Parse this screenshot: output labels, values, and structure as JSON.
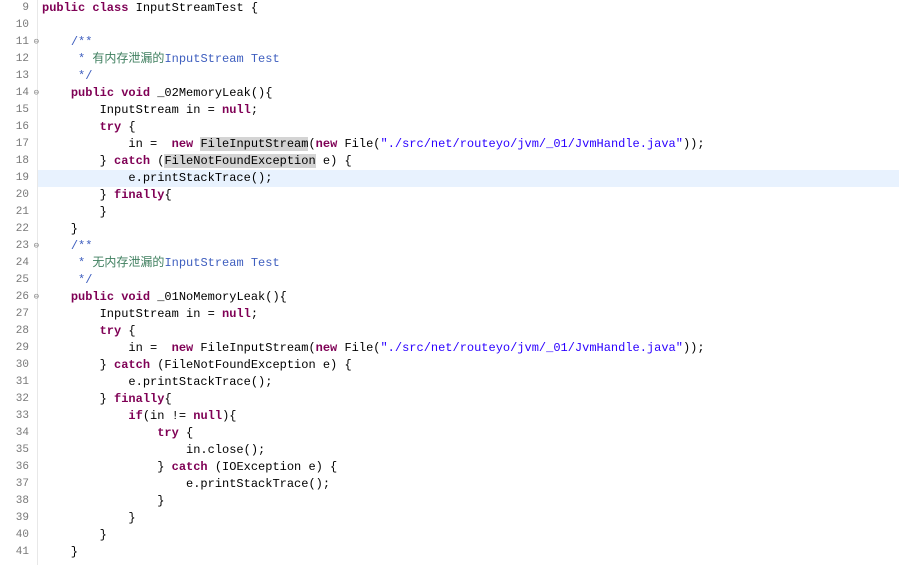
{
  "lines": [
    {
      "num": 9,
      "fold": "",
      "segments": [
        [
          "kw",
          "public class"
        ],
        [
          "normal",
          " InputStreamTest {"
        ]
      ]
    },
    {
      "num": 10,
      "fold": "",
      "segments": [
        [
          "normal",
          ""
        ]
      ]
    },
    {
      "num": 11,
      "fold": "⊖",
      "segments": [
        [
          "normal",
          "    "
        ],
        [
          "comment",
          "/**"
        ]
      ]
    },
    {
      "num": 12,
      "fold": "",
      "segments": [
        [
          "normal",
          "    "
        ],
        [
          "comment",
          " * "
        ],
        [
          "comment-cjk",
          "有内存泄漏的"
        ],
        [
          "comment",
          "InputStream Test"
        ]
      ]
    },
    {
      "num": 13,
      "fold": "",
      "segments": [
        [
          "normal",
          "    "
        ],
        [
          "comment",
          " */"
        ]
      ]
    },
    {
      "num": 14,
      "fold": "⊖",
      "segments": [
        [
          "normal",
          "    "
        ],
        [
          "kw",
          "public void"
        ],
        [
          "normal",
          " _02MemoryLeak(){"
        ]
      ]
    },
    {
      "num": 15,
      "fold": "",
      "segments": [
        [
          "normal",
          "        InputStream in = "
        ],
        [
          "kw",
          "null"
        ],
        [
          "normal",
          ";"
        ]
      ]
    },
    {
      "num": 16,
      "fold": "",
      "segments": [
        [
          "normal",
          "        "
        ],
        [
          "kw",
          "try"
        ],
        [
          "normal",
          " {"
        ]
      ]
    },
    {
      "num": 17,
      "fold": "",
      "segments": [
        [
          "normal",
          "            in =  "
        ],
        [
          "kw",
          "new"
        ],
        [
          "normal",
          " "
        ],
        [
          "occur",
          "FileInputStream"
        ],
        [
          "normal",
          "("
        ],
        [
          "kw",
          "new"
        ],
        [
          "normal",
          " File("
        ],
        [
          "string",
          "\"./src/net/routeyo/jvm/_01/JvmHandle.java\""
        ],
        [
          "normal",
          "));"
        ]
      ]
    },
    {
      "num": 18,
      "fold": "",
      "segments": [
        [
          "normal",
          "        } "
        ],
        [
          "kw",
          "catch"
        ],
        [
          "normal",
          " ("
        ],
        [
          "occur",
          "FileNotFoundException"
        ],
        [
          "normal",
          " e) {"
        ]
      ]
    },
    {
      "num": 19,
      "fold": "",
      "highlighted": true,
      "segments": [
        [
          "normal",
          "            e.printStackTrace();"
        ]
      ]
    },
    {
      "num": 20,
      "fold": "",
      "segments": [
        [
          "normal",
          "        } "
        ],
        [
          "kw",
          "finally"
        ],
        [
          "normal",
          "{"
        ]
      ]
    },
    {
      "num": 21,
      "fold": "",
      "segments": [
        [
          "normal",
          "        }"
        ]
      ]
    },
    {
      "num": 22,
      "fold": "",
      "segments": [
        [
          "normal",
          "    }"
        ]
      ]
    },
    {
      "num": 23,
      "fold": "⊖",
      "segments": [
        [
          "normal",
          "    "
        ],
        [
          "comment",
          "/**"
        ]
      ]
    },
    {
      "num": 24,
      "fold": "",
      "segments": [
        [
          "normal",
          "    "
        ],
        [
          "comment",
          " * "
        ],
        [
          "comment-cjk",
          "无内存泄漏的"
        ],
        [
          "comment",
          "InputStream Test"
        ]
      ]
    },
    {
      "num": 25,
      "fold": "",
      "segments": [
        [
          "normal",
          "    "
        ],
        [
          "comment",
          " */"
        ]
      ]
    },
    {
      "num": 26,
      "fold": "⊖",
      "segments": [
        [
          "normal",
          "    "
        ],
        [
          "kw",
          "public void"
        ],
        [
          "normal",
          " _01NoMemoryLeak(){"
        ]
      ]
    },
    {
      "num": 27,
      "fold": "",
      "segments": [
        [
          "normal",
          "        InputStream in = "
        ],
        [
          "kw",
          "null"
        ],
        [
          "normal",
          ";"
        ]
      ]
    },
    {
      "num": 28,
      "fold": "",
      "segments": [
        [
          "normal",
          "        "
        ],
        [
          "kw",
          "try"
        ],
        [
          "normal",
          " {"
        ]
      ]
    },
    {
      "num": 29,
      "fold": "",
      "segments": [
        [
          "normal",
          "            in =  "
        ],
        [
          "kw",
          "new"
        ],
        [
          "normal",
          " FileInputStream("
        ],
        [
          "kw",
          "new"
        ],
        [
          "normal",
          " File("
        ],
        [
          "string",
          "\"./src/net/routeyo/jvm/_01/JvmHandle.java\""
        ],
        [
          "normal",
          "));"
        ]
      ]
    },
    {
      "num": 30,
      "fold": "",
      "segments": [
        [
          "normal",
          "        } "
        ],
        [
          "kw",
          "catch"
        ],
        [
          "normal",
          " (FileNotFoundException e) {"
        ]
      ]
    },
    {
      "num": 31,
      "fold": "",
      "segments": [
        [
          "normal",
          "            e.printStackTrace();"
        ]
      ]
    },
    {
      "num": 32,
      "fold": "",
      "segments": [
        [
          "normal",
          "        } "
        ],
        [
          "kw",
          "finally"
        ],
        [
          "normal",
          "{"
        ]
      ]
    },
    {
      "num": 33,
      "fold": "",
      "segments": [
        [
          "normal",
          "            "
        ],
        [
          "kw",
          "if"
        ],
        [
          "normal",
          "(in != "
        ],
        [
          "kw",
          "null"
        ],
        [
          "normal",
          "){"
        ]
      ]
    },
    {
      "num": 34,
      "fold": "",
      "segments": [
        [
          "normal",
          "                "
        ],
        [
          "kw",
          "try"
        ],
        [
          "normal",
          " {"
        ]
      ]
    },
    {
      "num": 35,
      "fold": "",
      "segments": [
        [
          "normal",
          "                    in.close();"
        ]
      ]
    },
    {
      "num": 36,
      "fold": "",
      "segments": [
        [
          "normal",
          "                } "
        ],
        [
          "kw",
          "catch"
        ],
        [
          "normal",
          " (IOException e) {"
        ]
      ]
    },
    {
      "num": 37,
      "fold": "",
      "segments": [
        [
          "normal",
          "                    e.printStackTrace();"
        ]
      ]
    },
    {
      "num": 38,
      "fold": "",
      "segments": [
        [
          "normal",
          "                }"
        ]
      ]
    },
    {
      "num": 39,
      "fold": "",
      "segments": [
        [
          "normal",
          "            }"
        ]
      ]
    },
    {
      "num": 40,
      "fold": "",
      "segments": [
        [
          "normal",
          "        }"
        ]
      ]
    },
    {
      "num": 41,
      "fold": "",
      "segments": [
        [
          "normal",
          "    }"
        ]
      ]
    }
  ]
}
